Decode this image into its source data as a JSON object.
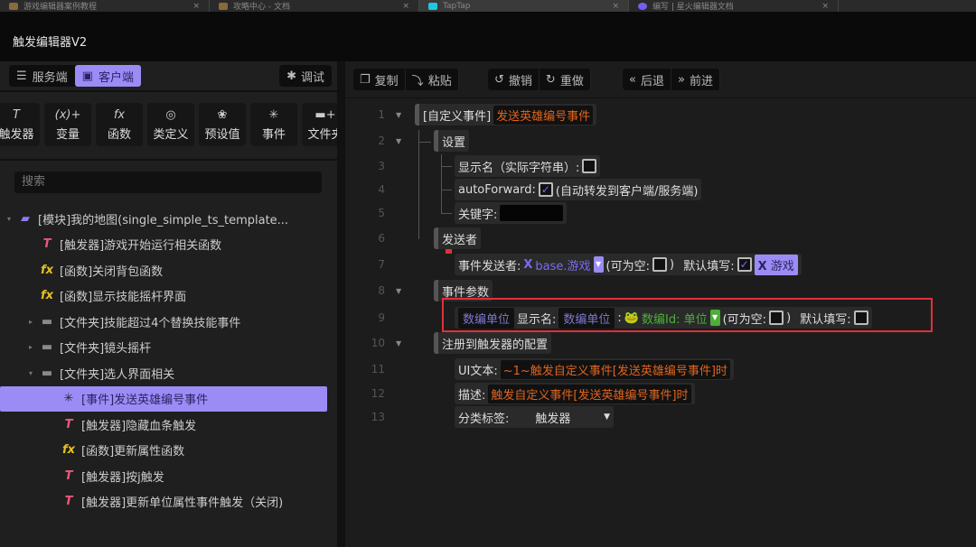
{
  "browser_tabs": [
    "游戏编辑器案例教程",
    "攻略中心 - 文档",
    "TapTap",
    "编写 | 星火编辑器文档"
  ],
  "app_title": "触发编辑器V2",
  "left": {
    "segments": [
      "服务端",
      "客户端"
    ],
    "debug_label": "调试",
    "tools": [
      {
        "icon": "trigger-icon",
        "glyph": "T",
        "label": "触发器"
      },
      {
        "icon": "variable-icon",
        "glyph": "(x)+",
        "label": "变量"
      },
      {
        "icon": "function-icon",
        "glyph": "fx",
        "label": "函数"
      },
      {
        "icon": "class-icon",
        "glyph": "◎",
        "label": "类定义"
      },
      {
        "icon": "preset-icon",
        "glyph": "❀",
        "label": "预设值"
      },
      {
        "icon": "event-icon",
        "glyph": "✳",
        "label": "事件"
      },
      {
        "icon": "new-folder-icon",
        "glyph": "▬+",
        "label": "文件夹"
      }
    ],
    "search_placeholder": "搜索",
    "tree": [
      {
        "label": "[模块]我的地图(single_simple_ts_template...",
        "type": "module",
        "indent": 0,
        "arrow": "▾"
      },
      {
        "label": "[触发器]游戏开始运行相关函数",
        "type": "trigger",
        "indent": 1
      },
      {
        "label": "[函数]关闭背包函数",
        "type": "function",
        "indent": 1
      },
      {
        "label": "[函数]显示技能摇杆界面",
        "type": "function",
        "indent": 1
      },
      {
        "label": "[文件夹]技能超过4个替换技能事件",
        "type": "folder",
        "indent": 1,
        "arrow": "▸"
      },
      {
        "label": "[文件夹]镜头摇杆",
        "type": "folder",
        "indent": 1,
        "arrow": "▸"
      },
      {
        "label": "[文件夹]选人界面相关",
        "type": "folder",
        "indent": 1,
        "arrow": "▾"
      },
      {
        "label": "[事件]发送英雄编号事件",
        "type": "event",
        "indent": 2,
        "selected": true
      },
      {
        "label": "[触发器]隐藏血条触发",
        "type": "trigger",
        "indent": 2
      },
      {
        "label": "[函数]更新属性函数",
        "type": "function",
        "indent": 2
      },
      {
        "label": "[触发器]按j触发",
        "type": "trigger",
        "indent": 2
      },
      {
        "label": "[触发器]更新单位属性事件触发（关闭)",
        "type": "trigger",
        "indent": 2
      }
    ]
  },
  "toolbar": {
    "copy": "复制",
    "paste": "粘贴",
    "undo": "撤销",
    "redo": "重做",
    "back": "后退",
    "forward": "前进"
  },
  "editor": {
    "line_numbers": [
      "1",
      "2",
      "3",
      "4",
      "5",
      "6",
      "7",
      "8",
      "9",
      "10",
      "11",
      "12",
      "13"
    ],
    "root_prefix": "[自定义事件]",
    "root_name": "发送英雄编号事件",
    "settings": "设置",
    "display_name_label": "显示名（实际字符串）:",
    "auto_forward_label": "autoForward:",
    "auto_forward_checked": true,
    "auto_forward_desc": "(自动转发到客户端/服务端)",
    "keyword_label": "关键字:",
    "sender_section": "发送者",
    "sender_label": "事件发送者:",
    "sender_type": "base.游戏",
    "nullable_label": "(可为空:",
    "nullable_close": ")",
    "default_label": "默认填写:",
    "sender_default": "游戏",
    "params_section": "事件参数",
    "param_name": "数编单位",
    "param_display_label": "显示名:",
    "param_display": "数编单位",
    "param_type": "数编Id: 单位",
    "register_section": "注册到触发器的配置",
    "ui_text_label": "UI文本:",
    "ui_text": "~1~触发自定义事件[发送英雄编号事件]时",
    "desc_label": "描述:",
    "desc": "触发自定义事件[发送英雄编号事件]时",
    "category_label": "分类标签:",
    "category": "触发器"
  },
  "colors": {
    "accent": "#9b8cf5",
    "orange": "#e0641e",
    "green": "#4caf3a",
    "highlight": "#e0303a"
  }
}
